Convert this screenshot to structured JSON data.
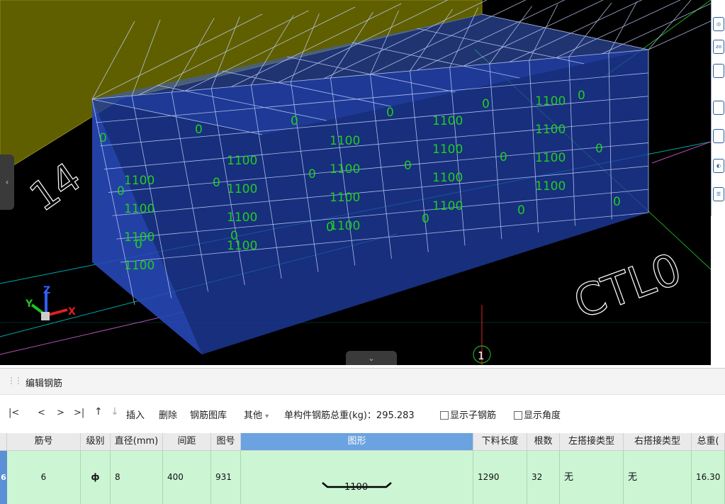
{
  "viewport": {
    "axis_labels": {
      "x": "X",
      "y": "Y",
      "z": "Z"
    },
    "floor_text": "CTL0",
    "floor_text2": "14",
    "circle_marker": "1",
    "rebar_labels": [
      "0",
      "0",
      "0",
      "0",
      "0",
      "0",
      "0",
      "0",
      "0",
      "0",
      "0",
      "0",
      "0",
      "0",
      "0",
      "0",
      "0",
      "0",
      "1100",
      "1100",
      "1100",
      "1100",
      "1100",
      "1100",
      "1100",
      "1100",
      "1100",
      "1100",
      "1100",
      "1100",
      "1100",
      "1100",
      "1100",
      "1100",
      "1100",
      "1100",
      "1100",
      "1100"
    ]
  },
  "side_toolbar": {
    "zoom_label": "zo"
  },
  "panel": {
    "title": "编辑钢筋"
  },
  "toolbar": {
    "first": "|<",
    "prev": "<",
    "next": ">",
    "last": ">|",
    "up": "↑",
    "down": "↓",
    "insert": "插入",
    "delete": "删除",
    "library": "钢筋图库",
    "other": "其他",
    "other_caret": "▾",
    "weight_label": "单构件钢筋总重(kg)：295.283",
    "show_sub_label": "显示子钢筋",
    "show_angle_label": "显示角度"
  },
  "table": {
    "columns": [
      "筋号",
      "级别",
      "直径(mm)",
      "间距",
      "图号",
      "图形",
      "下料长度",
      "根数",
      "左搭接类型",
      "右搭接类型",
      "总重("
    ],
    "row": {
      "index": "6",
      "no": "6",
      "grade": "ф",
      "diameter": "8",
      "spacing": "400",
      "fig_no": "931",
      "shape_value": "1100",
      "cut_length": "1290",
      "count": "32",
      "left_lap": "无",
      "right_lap": "无",
      "total_weight": "16.30"
    }
  },
  "colors": {
    "viewport_bg": "#000000",
    "slab": "#5f5f00",
    "box_fill": "#1e3ca0",
    "rebar_label": "#22cc22",
    "selected_row": "#ccf5d4",
    "active_header": "#6aa3e0"
  }
}
